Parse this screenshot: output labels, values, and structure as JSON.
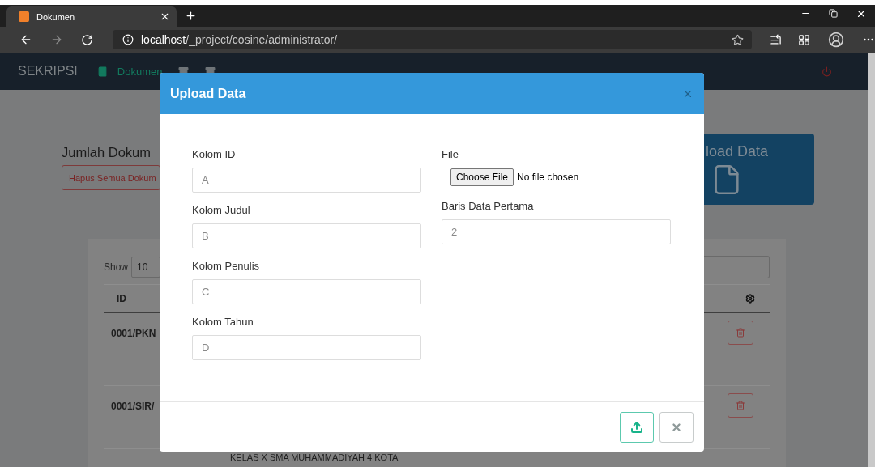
{
  "browser": {
    "tab_title": "Dokumen",
    "url_host": "localhost",
    "url_path": "/_project/cosine/administrator/"
  },
  "navbar": {
    "brand": "SEKRIPSI",
    "items": [
      {
        "label": "Dokumen",
        "kind": "book",
        "selected": true
      },
      {
        "kind": "archive",
        "selected": false
      },
      {
        "kind": "archive",
        "selected": false
      }
    ]
  },
  "page": {
    "heading": "Jumlah Dokum",
    "delete_all_button": "Hapus Semua Dokum",
    "upload_card": "load Data",
    "table": {
      "show_label": "Show",
      "page_size": "10",
      "columns": [
        "ID"
      ],
      "rows": [
        {
          "id": "0001/PKN"
        },
        {
          "id": "0001/SIR/"
        }
      ],
      "below_text": "KELAS X SMA MUHAMMADIYAH 4 KOTA"
    }
  },
  "modal": {
    "title": "Upload Data",
    "fields": [
      {
        "label": "Kolom ID",
        "placeholder": "A"
      },
      {
        "label": "Kolom Judul",
        "placeholder": "B"
      },
      {
        "label": "Kolom Penulis",
        "placeholder": "C"
      },
      {
        "label": "Kolom Tahun",
        "placeholder": "D"
      }
    ],
    "file": {
      "label": "File",
      "button": "Choose File",
      "status": "No file chosen"
    },
    "first_row": {
      "label": "Baris Data Pertama",
      "placeholder": "2"
    }
  }
}
